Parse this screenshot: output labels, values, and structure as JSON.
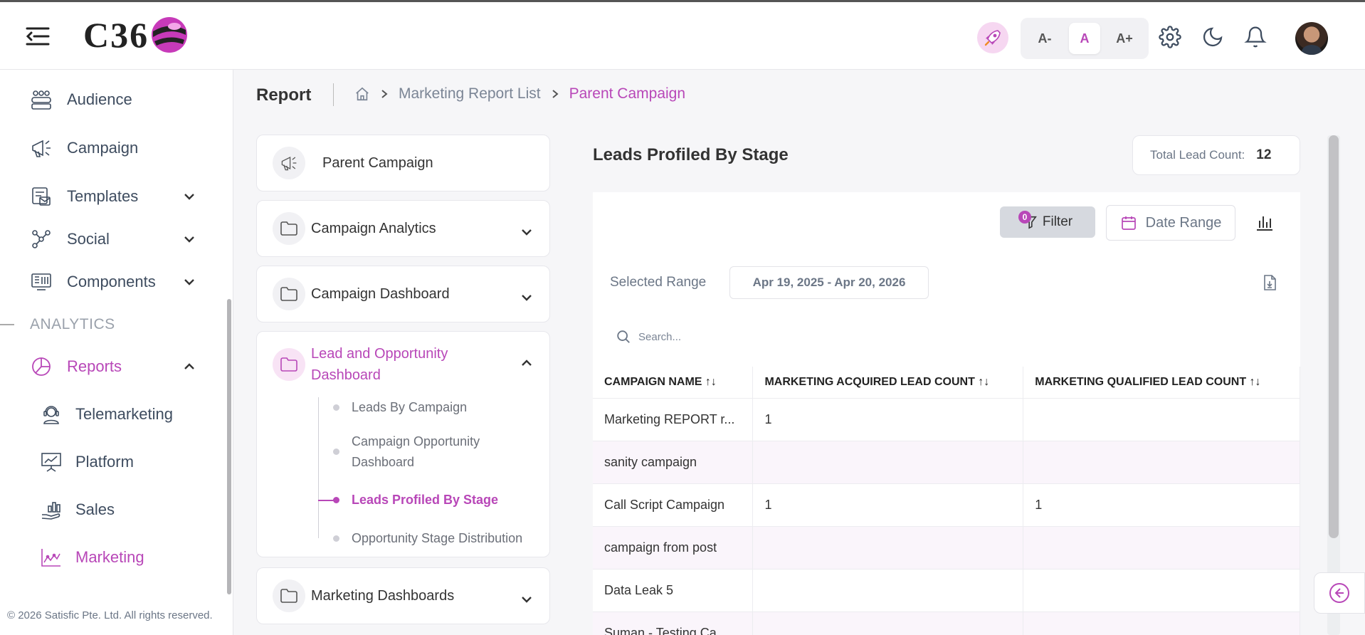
{
  "brand": {
    "logo_text": "C36"
  },
  "header": {
    "font_small": "A-",
    "font_normal": "A",
    "font_large": "A+"
  },
  "sidebar": {
    "items": [
      {
        "label": "Audience",
        "icon": "audience-icon"
      },
      {
        "label": "Campaign",
        "icon": "megaphone-icon"
      },
      {
        "label": "Templates",
        "icon": "template-icon"
      },
      {
        "label": "Social",
        "icon": "social-icon"
      },
      {
        "label": "Components",
        "icon": "components-icon"
      }
    ],
    "section_label": "ANALYTICS",
    "reports_label": "Reports",
    "sub_items": [
      {
        "label": "Telemarketing"
      },
      {
        "label": "Platform"
      },
      {
        "label": "Sales"
      },
      {
        "label": "Marketing"
      }
    ],
    "copyright": "© 2026 Satisfic Pte. Ltd. All rights reserved."
  },
  "page": {
    "title": "Report",
    "breadcrumb": [
      "Marketing Report List",
      "Parent Campaign"
    ]
  },
  "nav_cards": {
    "parent": "Parent Campaign",
    "analytics": "Campaign Analytics",
    "dashboard": "Campaign Dashboard",
    "lead_title": "Lead and Opportunity Dashboard",
    "lead_items": [
      "Leads By Campaign",
      "Campaign Opportunity Dashboard",
      "Leads Profiled By Stage",
      "Opportunity Stage Distribution"
    ],
    "marketing": "Marketing Dashboards"
  },
  "main": {
    "title": "Leads Profiled By Stage",
    "total_label": "Total Lead Count:",
    "total_value": "12",
    "filter_label": "Filter",
    "filter_badge": "0",
    "date_range_label": "Date Range",
    "selected_range_label": "Selected Range",
    "selected_range_value": "Apr 19, 2025 - Apr 20, 2026",
    "search_placeholder": "Search..."
  },
  "table": {
    "headers": [
      "CAMPAIGN NAME ↑↓",
      "MARKETING ACQUIRED LEAD COUNT ↑↓",
      "MARKETING QUALIFIED LEAD COUNT ↑↓"
    ],
    "rows": [
      [
        "Marketing REPORT r...",
        "1",
        ""
      ],
      [
        "sanity campaign",
        "",
        ""
      ],
      [
        "Call Script Campaign",
        "1",
        "1"
      ],
      [
        "campaign from post",
        "",
        ""
      ],
      [
        "Data Leak 5",
        "",
        ""
      ],
      [
        "Suman - Testing Ca...",
        "",
        ""
      ]
    ]
  },
  "colors": {
    "accent": "#b847b8",
    "text": "#3e4c5f",
    "muted": "#6b7686"
  }
}
